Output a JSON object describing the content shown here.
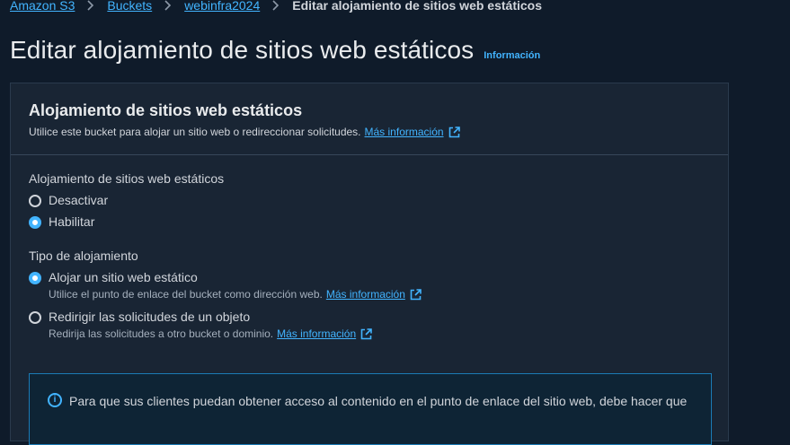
{
  "breadcrumb": {
    "items": [
      "Amazon S3",
      "Buckets",
      "webinfra2024"
    ],
    "current": "Editar alojamiento de sitios web estáticos"
  },
  "page": {
    "title": "Editar alojamiento de sitios web estáticos",
    "info_link": "Información"
  },
  "panel": {
    "title": "Alojamiento de sitios web estáticos",
    "description": "Utilice este bucket para alojar un sitio web o redireccionar solicitudes.",
    "more_info": "Más información"
  },
  "hosting": {
    "label": "Alojamiento de sitios web estáticos",
    "options": [
      {
        "label": "Desactivar",
        "checked": false
      },
      {
        "label": "Habilitar",
        "checked": true
      }
    ]
  },
  "hosting_type": {
    "label": "Tipo de alojamiento",
    "options": [
      {
        "label": "Alojar un sitio web estático",
        "sub": "Utilice el punto de enlace del bucket como dirección web.",
        "link": "Más información",
        "checked": true
      },
      {
        "label": "Redirigir las solicitudes de un objeto",
        "sub": "Redirija las solicitudes a otro bucket o dominio.",
        "link": "Más información",
        "checked": false
      }
    ]
  },
  "alert": {
    "text": "Para que sus clientes puedan obtener acceso al contenido en el punto de enlace del sitio web, debe hacer que"
  },
  "colors": {
    "accent": "#42b4ff",
    "background": "#0f1b2a",
    "panel": "#192534"
  }
}
